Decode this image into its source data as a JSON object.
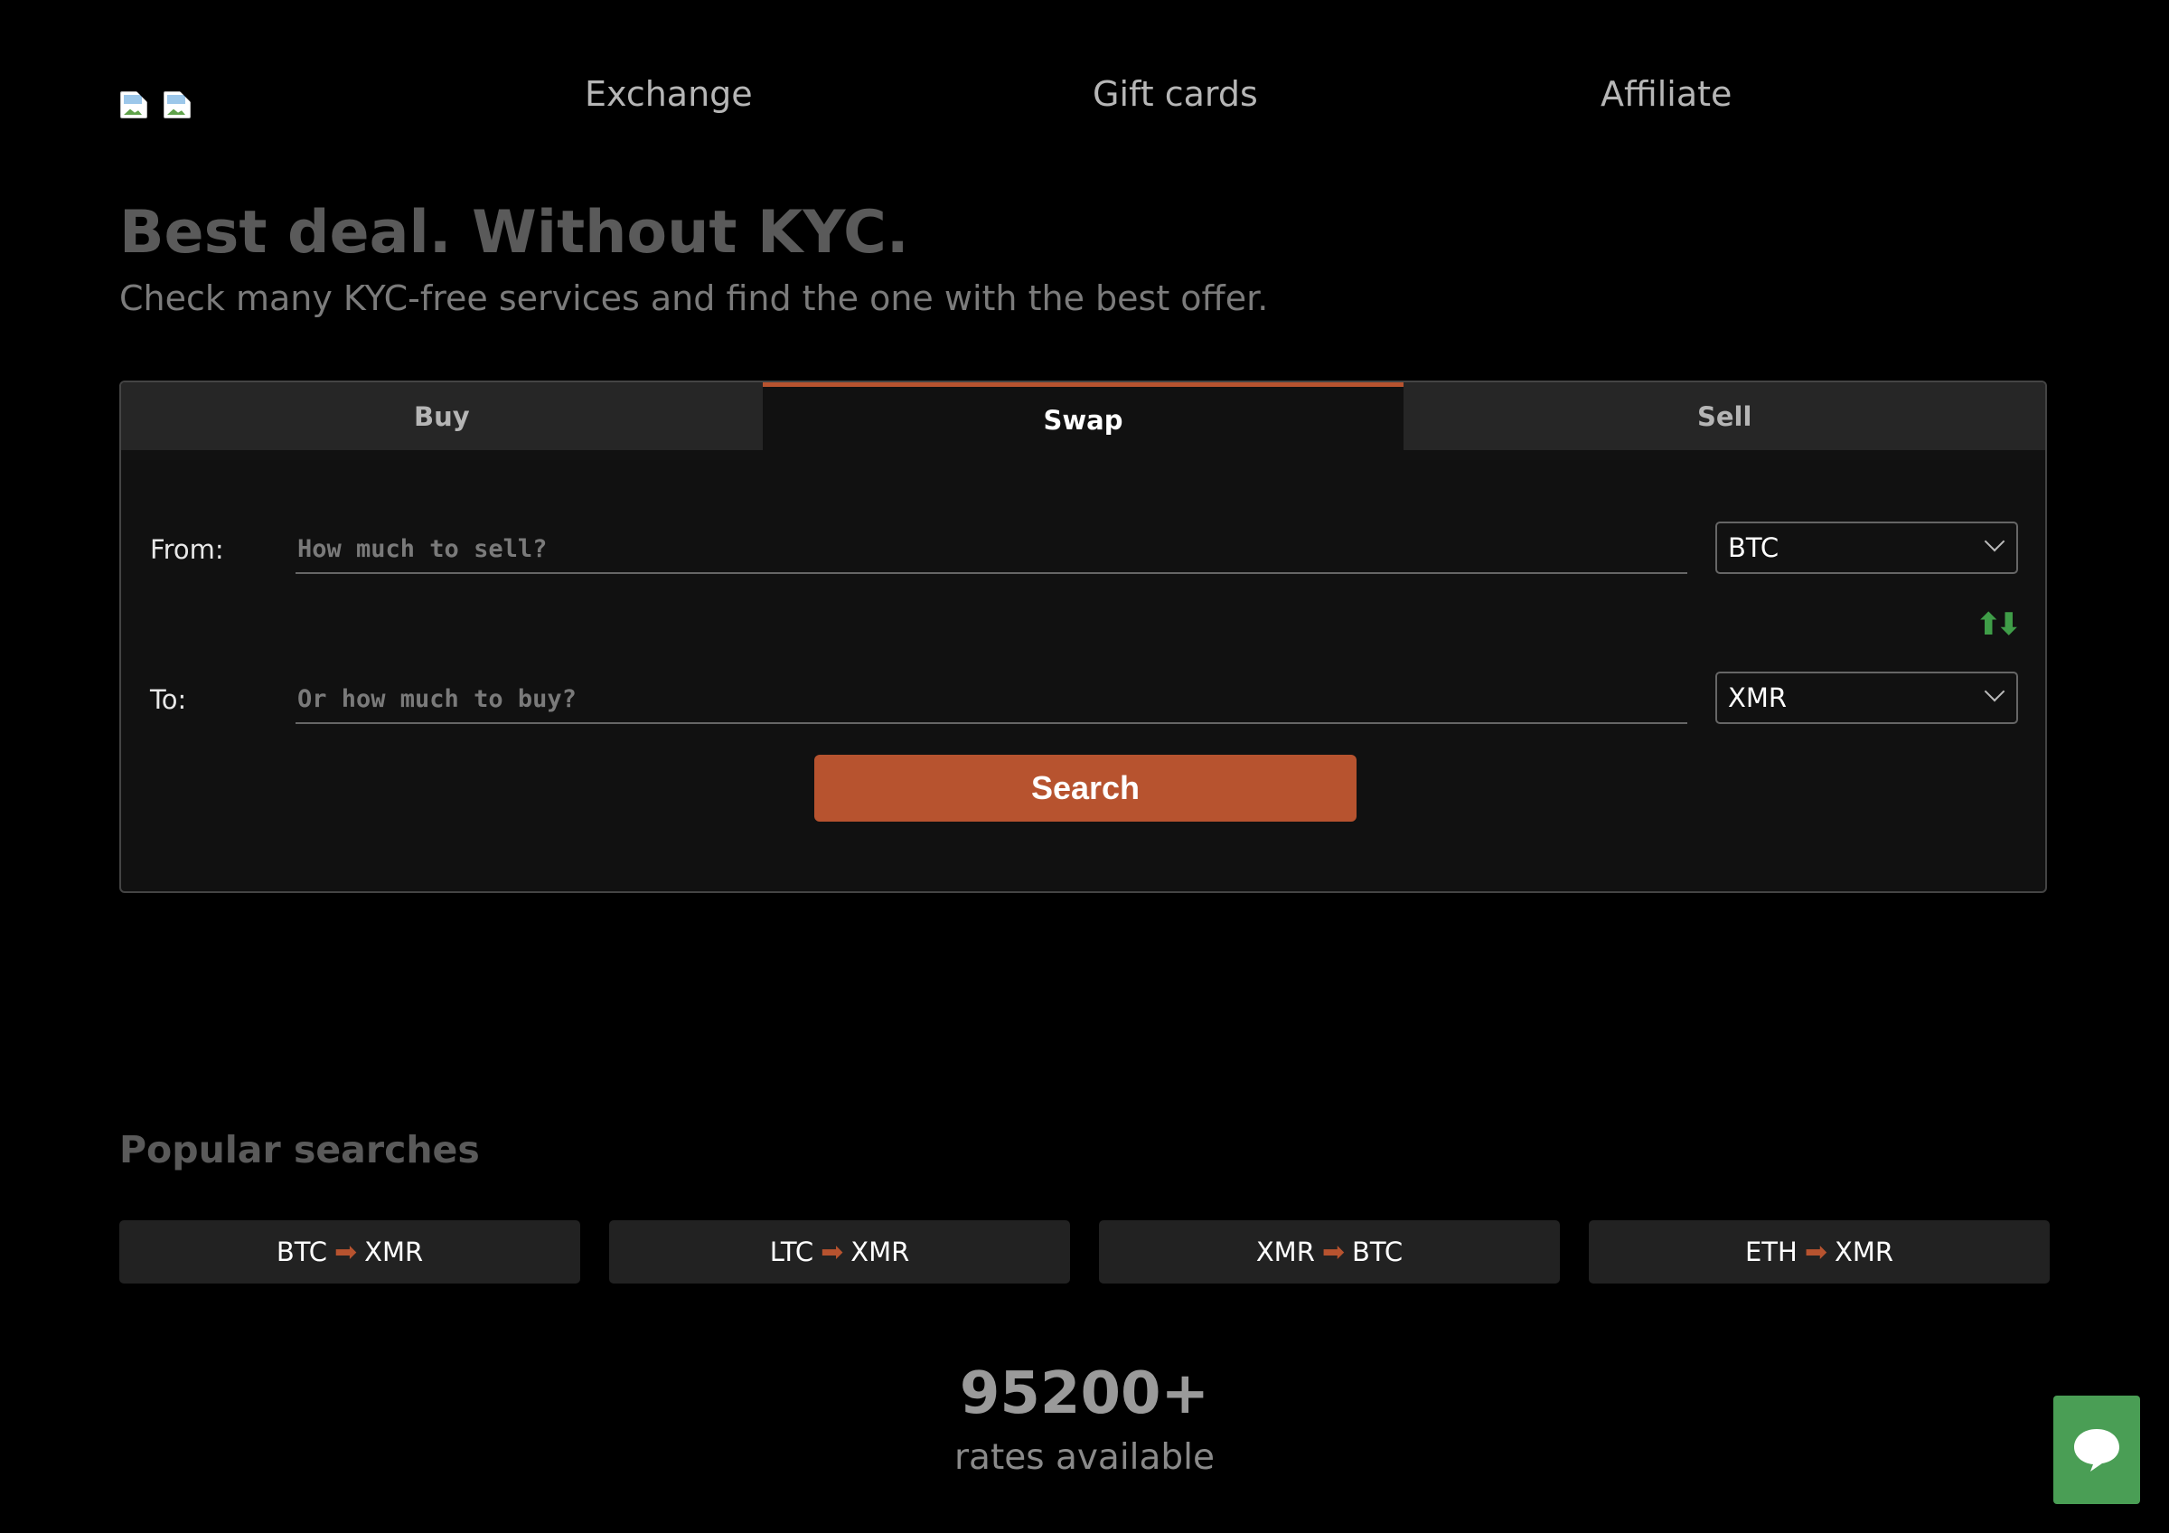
{
  "nav": {
    "links": [
      "Exchange",
      "Gift cards",
      "Affiliate"
    ]
  },
  "hero": {
    "title": "Best deal. Without KYC.",
    "subtitle": "Check many KYC-free services and find the one with the best offer."
  },
  "form": {
    "tabs": [
      "Buy",
      "Swap",
      "Sell"
    ],
    "active_tab": "Swap",
    "from_label": "From:",
    "from_placeholder": "How much to sell?",
    "from_value": "",
    "from_currency": "BTC",
    "to_label": "To:",
    "to_placeholder": "Or how much to buy?",
    "to_value": "",
    "to_currency": "XMR",
    "swap_icon": "up-down-arrows-icon",
    "search_label": "Search"
  },
  "popular": {
    "title": "Popular searches",
    "pairs": [
      {
        "from": "BTC",
        "arrow": "➡",
        "to": "XMR"
      },
      {
        "from": "LTC",
        "arrow": "➡",
        "to": "XMR"
      },
      {
        "from": "XMR",
        "arrow": "➡",
        "to": "BTC"
      },
      {
        "from": "ETH",
        "arrow": "➡",
        "to": "XMR"
      }
    ]
  },
  "stats": {
    "count": "95200+",
    "label": "rates available"
  },
  "colors": {
    "accent": "#b7532f",
    "chat": "#4a9e55",
    "swap_arrows": "#3f9d48"
  }
}
